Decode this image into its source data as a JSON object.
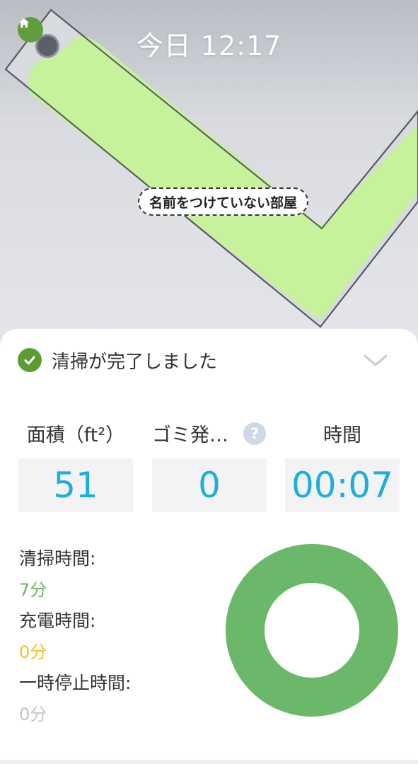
{
  "map": {
    "time_label": "今日 12:17",
    "room_label": "名前をつけていない部屋",
    "icons": {
      "home": "home-icon",
      "dock": "dock-marker"
    },
    "colors": {
      "cleaned_area": "#c5f29a",
      "room_outline": "#55595f"
    }
  },
  "summary": {
    "status_text": "清掃が完了しました",
    "status_icon": "check-circle-icon",
    "collapse_icon": "chevron-down-icon",
    "stats": [
      {
        "label": "面積（ft²）",
        "value": "51"
      },
      {
        "label": "ゴミ発…",
        "value": "0"
      },
      {
        "label": "時間",
        "value": "00:07"
      }
    ],
    "help_glyph": "?",
    "details": [
      {
        "label": "清掃時間:",
        "value": "7分",
        "color": "#6bb55e"
      },
      {
        "label": "充電時間:",
        "value": "0分",
        "color": "#f0c02e"
      },
      {
        "label": "一時停止時間:",
        "value": "0分",
        "color": "#c4c4c4"
      }
    ],
    "donut": {
      "segments": [
        {
          "name": "清掃時間",
          "minutes": 7,
          "color": "#6bb86a"
        },
        {
          "name": "充電時間",
          "minutes": 0,
          "color": "#f0c02e"
        },
        {
          "name": "一時停止時間",
          "minutes": 0,
          "color": "#c4c4c4"
        }
      ]
    },
    "accent_color": "#1eaedb"
  }
}
